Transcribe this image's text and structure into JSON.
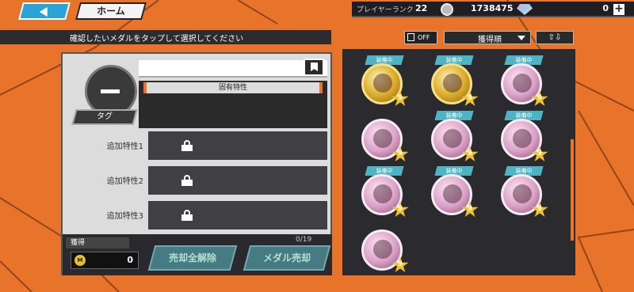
{
  "nav": {
    "home_label": "ホーム"
  },
  "status": {
    "rank_label": "プレイヤーランク",
    "rank_value": "22",
    "coins": "1738475",
    "gems": "0",
    "plus_label": "+"
  },
  "toolbar": {
    "instruction": "確認したいメダルをタップして選択してください",
    "fav_toggle": "OFF",
    "sort_label": "獲得順",
    "order_label": "⇧⇩"
  },
  "detail": {
    "unique_trait_label": "固有特性",
    "tag_label": "タグ",
    "extra_traits": [
      {
        "label": "追加特性1"
      },
      {
        "label": "追加特性2"
      },
      {
        "label": "追加特性3"
      }
    ],
    "acquire_label": "獲得",
    "acquire_icon": "M",
    "acquire_value": "0",
    "cancel_all_label": "売却全解除",
    "sell_label": "メダル売却",
    "sell_count": "0/19"
  },
  "medals": [
    {
      "equipped": true,
      "equip_label": "装備中",
      "level": "9",
      "color": "gold"
    },
    {
      "equipped": true,
      "equip_label": "装備中",
      "level": "9",
      "color": "gold"
    },
    {
      "equipped": true,
      "equip_label": "装備中",
      "level": "9",
      "color": "pink"
    },
    {
      "equipped": false,
      "equip_label": "",
      "level": "9",
      "color": "pink"
    },
    {
      "equipped": true,
      "equip_label": "装備中",
      "level": "9",
      "color": "pink"
    },
    {
      "equipped": true,
      "equip_label": "装備中",
      "level": "9",
      "color": "pink"
    },
    {
      "equipped": true,
      "equip_label": "装備中",
      "level": "9",
      "color": "pink"
    },
    {
      "equipped": true,
      "equip_label": "装備中",
      "level": "9",
      "color": "pink"
    },
    {
      "equipped": true,
      "equip_label": "装備中",
      "level": "9",
      "color": "pink"
    },
    {
      "equipped": false,
      "equip_label": "",
      "level": "9",
      "color": "pink"
    }
  ],
  "colors": {
    "accent": "#e8732a",
    "teal": "#4fb3c4",
    "panel": "#2b2b2f"
  }
}
